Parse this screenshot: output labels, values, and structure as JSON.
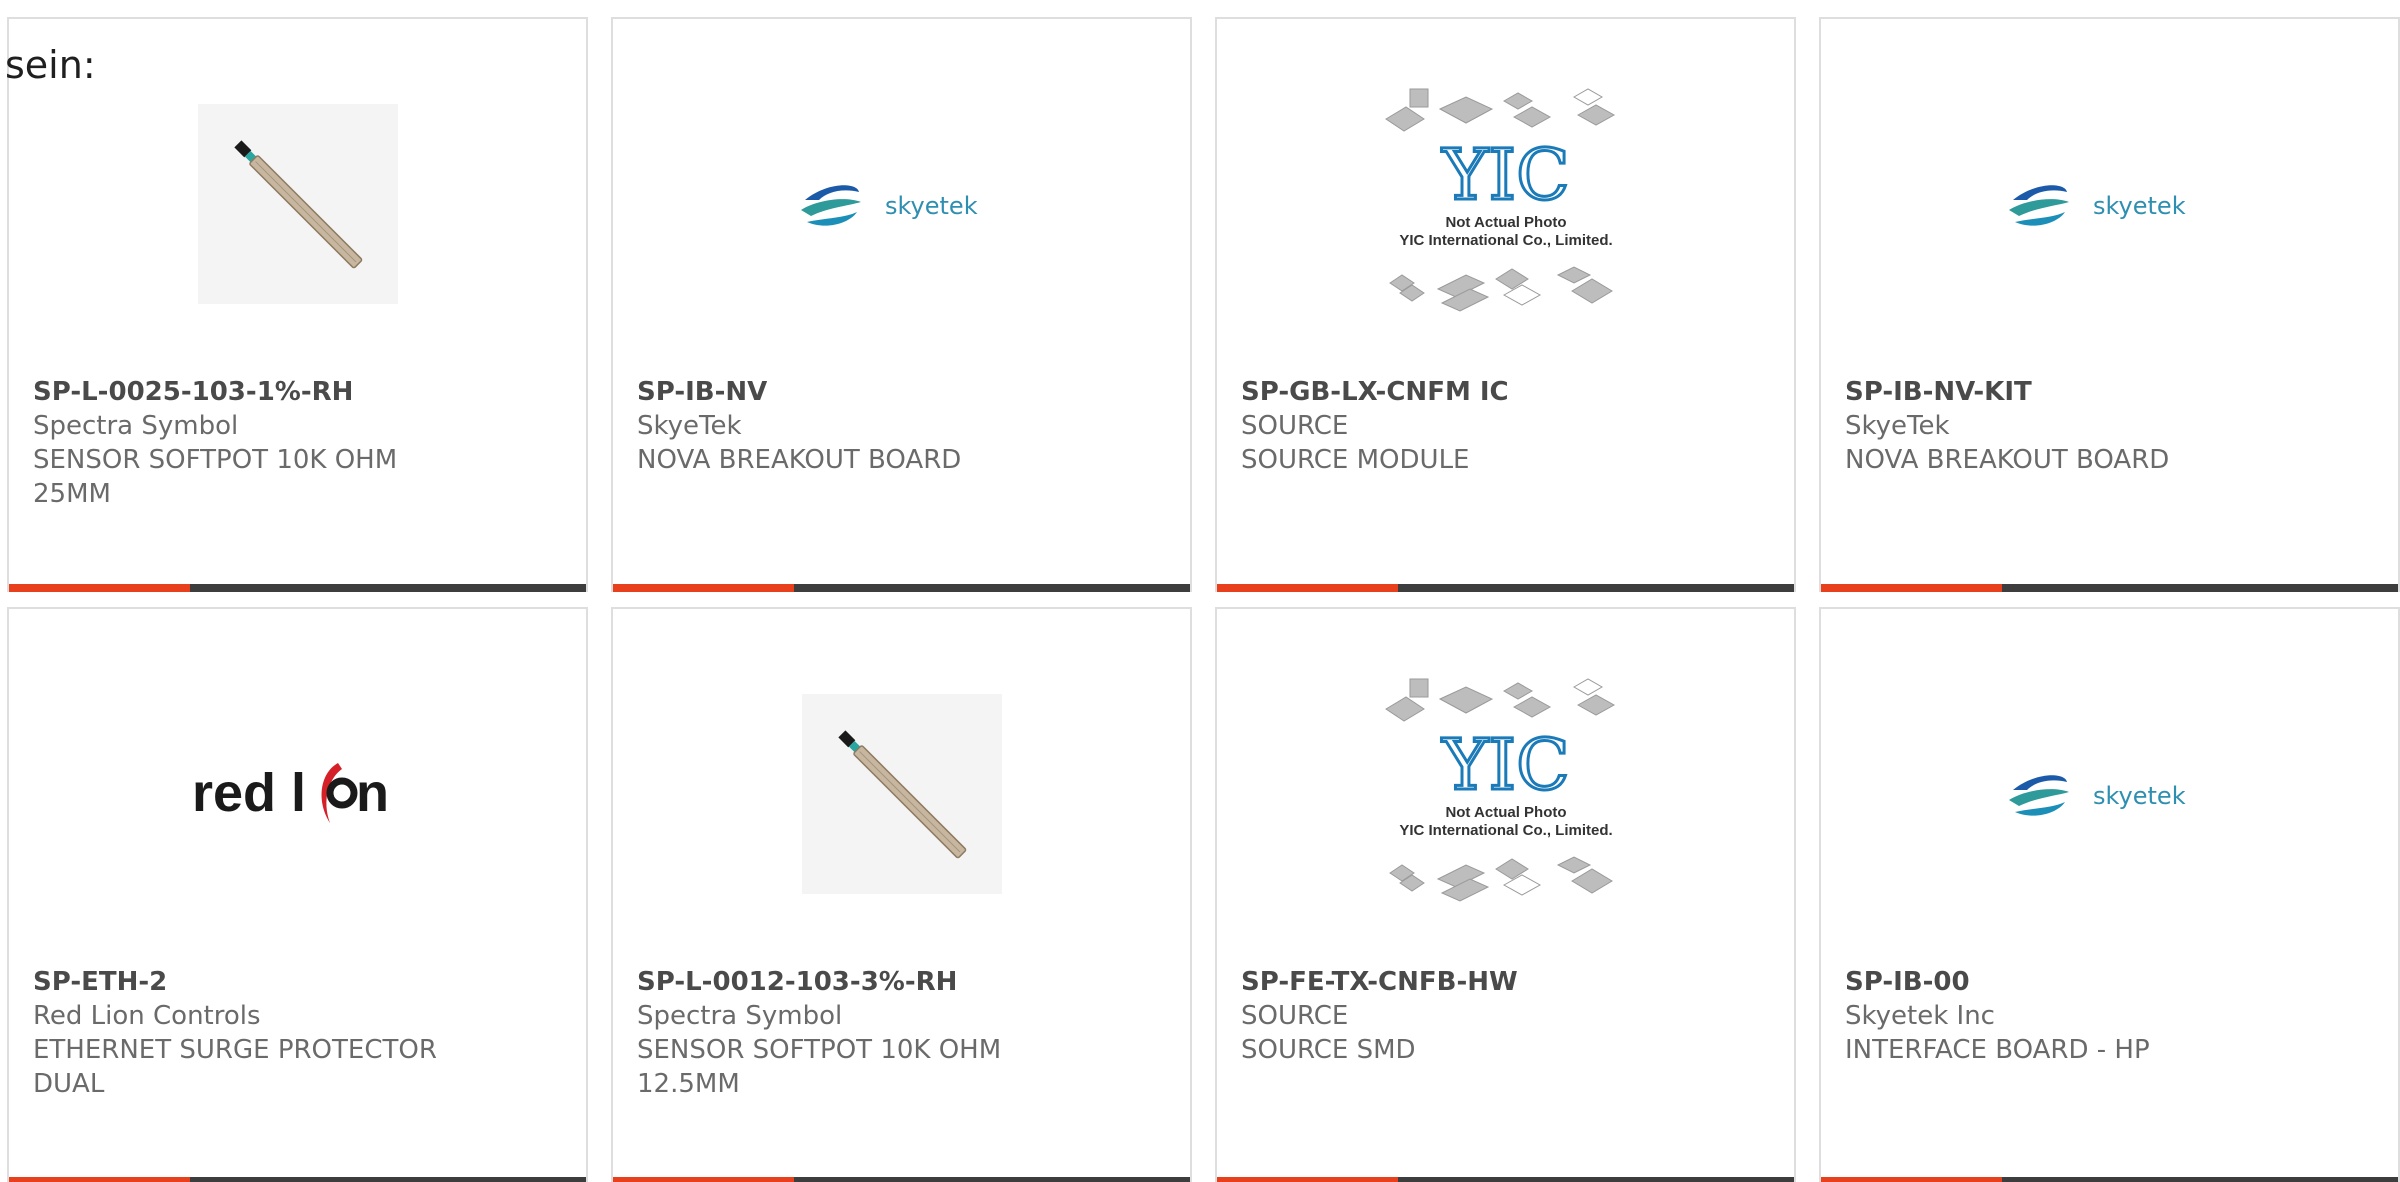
{
  "intro_text": "sein:",
  "colors": {
    "accent": "#e8401c",
    "bar": "#3d3d3d",
    "skyetek_teal": "#2e9a9a",
    "skyetek_blue": "#1b5aa8",
    "redlion_red": "#d62027"
  },
  "products": [
    {
      "part": "SP-L-0025-103-1%-RH",
      "manufacturer": "Spectra Symbol",
      "desc1": "SENSOR SOFTPOT 10K OHM",
      "desc2": "25MM",
      "image": "softpot-sensor"
    },
    {
      "part": "SP-IB-NV",
      "manufacturer": "SkyeTek",
      "desc1": "NOVA BREAKOUT BOARD",
      "desc2": "",
      "image": "skyetek-logo"
    },
    {
      "part": "SP-GB-LX-CNFM IC",
      "manufacturer": "SOURCE",
      "desc1": "SOURCE MODULE",
      "desc2": "",
      "image": "yic-placeholder"
    },
    {
      "part": "SP-IB-NV-KIT",
      "manufacturer": "SkyeTek",
      "desc1": "NOVA BREAKOUT BOARD",
      "desc2": "",
      "image": "skyetek-logo"
    },
    {
      "part": "SP-ETH-2",
      "manufacturer": "Red Lion Controls",
      "desc1": "ETHERNET SURGE PROTECTOR",
      "desc2": "DUAL",
      "image": "redlion-logo"
    },
    {
      "part": "SP-L-0012-103-3%-RH",
      "manufacturer": "Spectra Symbol",
      "desc1": "SENSOR SOFTPOT 10K OHM",
      "desc2": "12.5MM",
      "image": "softpot-sensor"
    },
    {
      "part": "SP-FE-TX-CNFB-HW",
      "manufacturer": "SOURCE",
      "desc1": "SOURCE SMD",
      "desc2": "",
      "image": "yic-placeholder"
    },
    {
      "part": "SP-IB-00",
      "manufacturer": "Skyetek Inc",
      "desc1": "INTERFACE BOARD - HP",
      "desc2": "",
      "image": "skyetek-logo"
    }
  ],
  "logos": {
    "skyetek_text": "skyetek",
    "redlion_word1": "red l",
    "redlion_word2": "n",
    "yic_mark": "YIC",
    "yic_line1": "Not Actual Photo",
    "yic_line2": "YIC International Co., Limited."
  }
}
